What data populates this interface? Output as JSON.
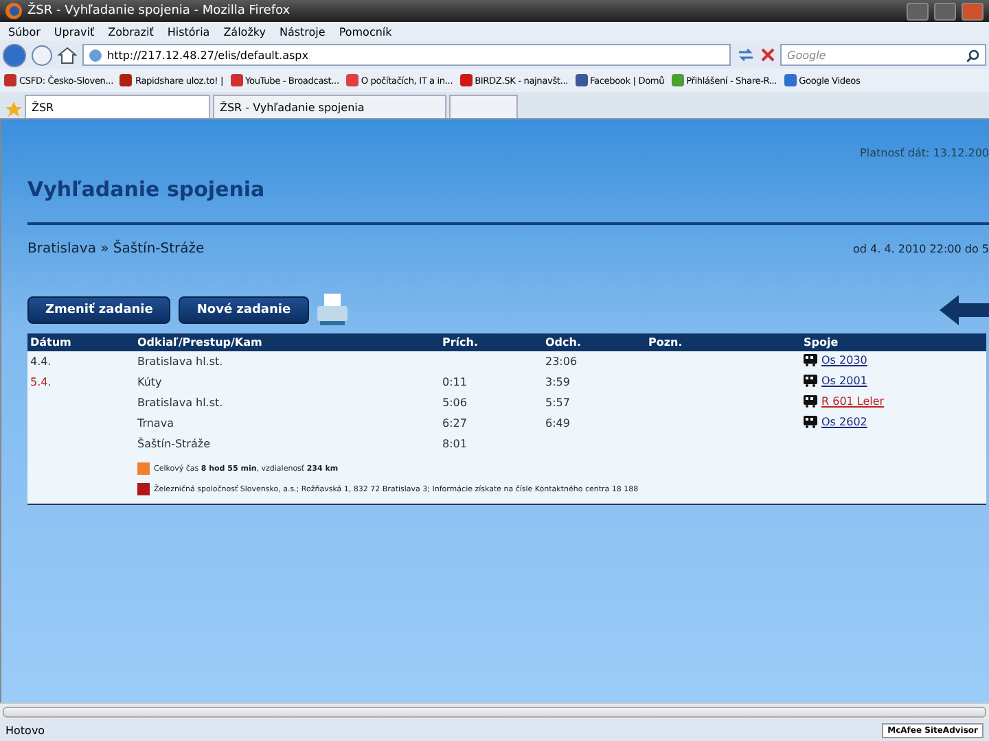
{
  "window": {
    "title": "ŽSR - Vyhľadanie spojenia - Mozilla Firefox"
  },
  "menu": [
    "Súbor",
    "Upraviť",
    "Zobraziť",
    "História",
    "Záložky",
    "Nástroje",
    "Pomocník"
  ],
  "address": {
    "value": "http://217.12.48.27/elis/default.aspx"
  },
  "search": {
    "placeholder": "Google"
  },
  "bookmarks": [
    {
      "label": "CSFD: Česko-Sloven...",
      "color": "#c0302a"
    },
    {
      "label": "Rapidshare uloz.to! |",
      "color": "#b02010"
    },
    {
      "label": "YouTube - Broadcast...",
      "color": "#d03030"
    },
    {
      "label": "O počítačích, IT a in...",
      "color": "#e04040"
    },
    {
      "label": "BIRDZ.SK - najnavšt...",
      "color": "#d01818"
    },
    {
      "label": "Facebook | Domů",
      "color": "#3b5998"
    },
    {
      "label": "Přihlášení - Share-R...",
      "color": "#4aa030"
    },
    {
      "label": "Google Videos",
      "color": "#3070d0"
    }
  ],
  "tabs": [
    {
      "label": "ŽSR",
      "selected": true
    },
    {
      "label": "ŽSR - Vyhľadanie spojenia",
      "selected": false
    }
  ],
  "page": {
    "title": "Vyhľadanie spojenia",
    "validity": "Platnosť dát:  13.12.200",
    "route": "Bratislava » Šaštín-Stráže",
    "period": "od 4. 4. 2010 22:00 do 5",
    "buttons": [
      "Zmeniť zadanie",
      "Nové zadanie"
    ],
    "table": {
      "columns": [
        "Dátum",
        "Odkiaľ/Prestup/Kam",
        "Prích.",
        "Odch.",
        "Pozn.",
        "Spoje"
      ],
      "rows": [
        {
          "date": "4.4.",
          "date_highlighted": false,
          "station": "Bratislava hl.st.",
          "departure": "23:06",
          "train": {
            "label": "Os 2030",
            "color": "#1a2a80"
          }
        },
        {
          "date": "5.4.",
          "date_highlighted": true,
          "station": "Kúty",
          "arrival": "0:11",
          "departure": "3:59",
          "train": {
            "label": "Os 2001",
            "color": "#1a2a80"
          }
        },
        {
          "station": "Bratislava hl.st.",
          "arrival": "5:06",
          "departure": "5:57",
          "train": {
            "label": "R 601 Leler",
            "color": "#c02020"
          }
        },
        {
          "station": "Trnava",
          "arrival": "6:27",
          "departure": "6:49",
          "train": {
            "label": "Os 2602",
            "color": "#1a2a80"
          }
        },
        {
          "station": "Šaštín-Stráže",
          "arrival": "8:01"
        }
      ]
    },
    "summary": "Celkový čas **8 hod 55 min**, vzdialenosť **234 km**",
    "footer": "Železničná spoločnosť Slovensko, a.s.; Rožňavská 1, 832 72 Bratislava 3; Informácie získate na čísle Kontaktného centra 18 188"
  },
  "status_bar": {
    "text": "Hotovo",
    "addon": "McAfee SiteAdvisor"
  }
}
